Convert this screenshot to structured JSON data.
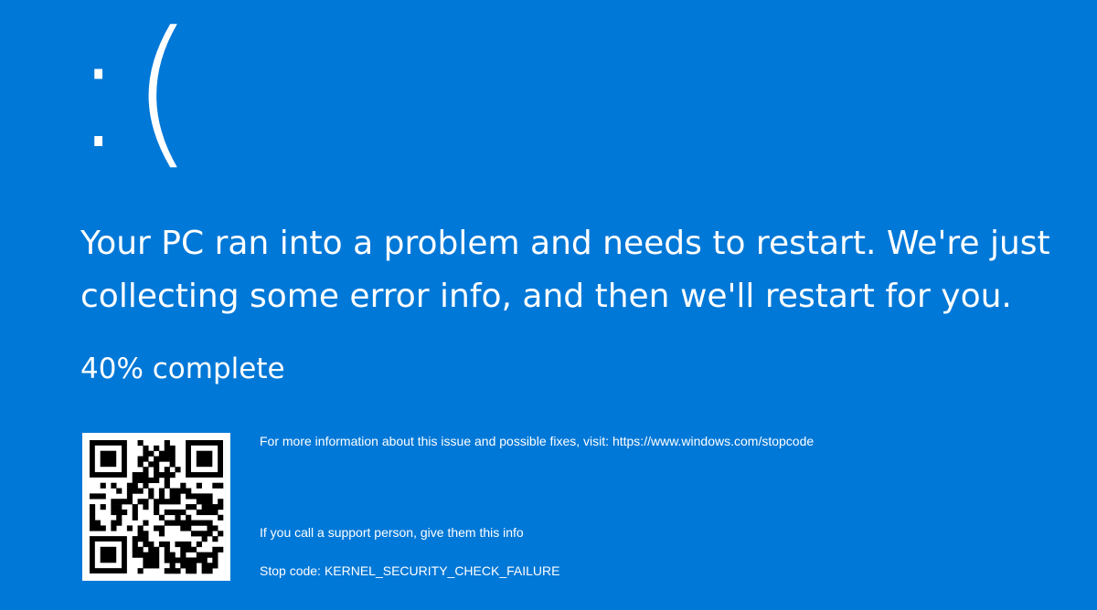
{
  "screen": {
    "background_color": "#0078d7",
    "text_color": "#ffffff",
    "emoticon": ":(",
    "message": "Your PC ran into a problem and needs to restart. We're just collecting some error info, and then we'll restart for you.",
    "progress": {
      "percent": 40,
      "text": "40% complete"
    },
    "qr_code": {
      "icon": "qr-code-icon"
    },
    "more_info_text": "For more information about this issue and possible fixes, visit: https://www.windows.com/stopcode",
    "support_text": "If you call a support person, give them this info",
    "stop_code_label": "Stop code:",
    "stop_code": "KERNEL_SECURITY_CHECK_FAILURE"
  }
}
